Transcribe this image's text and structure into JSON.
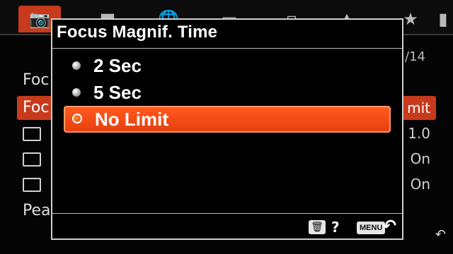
{
  "background": {
    "page_indicator": "/14",
    "rows": [
      {
        "label": "Foc",
        "value": ""
      },
      {
        "label": "Foc",
        "value": "mit"
      },
      {
        "label": "",
        "value": "1.0"
      },
      {
        "label": "",
        "value": "On"
      },
      {
        "label": "",
        "value": "On"
      },
      {
        "label": "Pea",
        "value": ""
      }
    ]
  },
  "dialog": {
    "title": "Focus Magnif. Time",
    "options": [
      {
        "label": "2 Sec",
        "selected": false
      },
      {
        "label": "5 Sec",
        "selected": false
      },
      {
        "label": "No Limit",
        "selected": true
      }
    ],
    "footer": {
      "trash_icon": "trash-icon",
      "help_label": "?",
      "menu_label": "MENU",
      "back_icon": "return-arrow-icon"
    }
  },
  "colors": {
    "selected_fill": "#ff4f14",
    "tab_active": "#c73a1c",
    "border": "#cfcfcf"
  }
}
